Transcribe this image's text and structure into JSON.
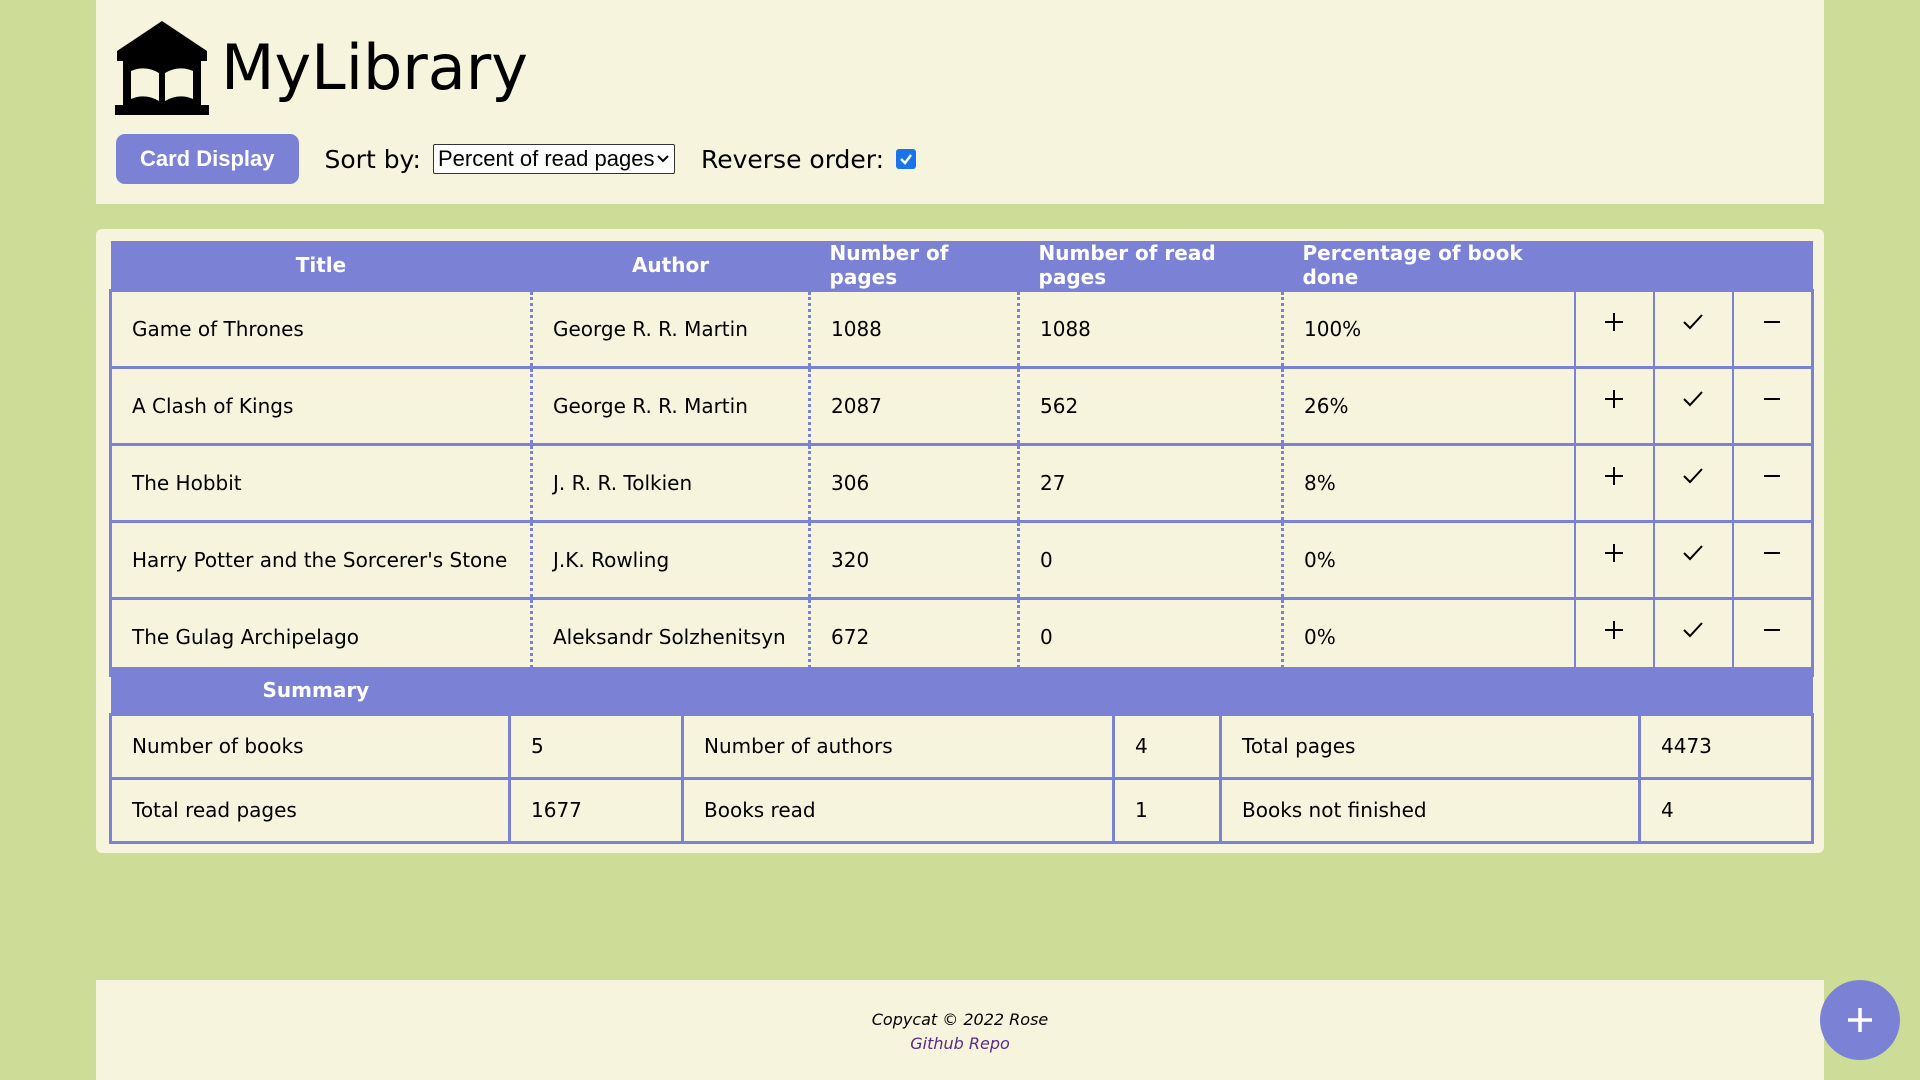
{
  "header": {
    "app_title": "MyLibrary",
    "logo_icon": "library-building-icon",
    "card_display_label": "Card Display",
    "sort_label": "Sort by:",
    "sort_selected": "Percent of read pages",
    "reverse_label": "Reverse order:",
    "reverse_checked": true
  },
  "table": {
    "columns": [
      "Title",
      "Author",
      "Number of pages",
      "Number of read pages",
      "Percentage of book done"
    ],
    "actions": [
      "plus-icon",
      "check-icon",
      "minus-icon"
    ],
    "rows": [
      {
        "title": "Game of Thrones",
        "author": "George R. R. Martin",
        "pages": "1088",
        "read": "1088",
        "percent": "100%"
      },
      {
        "title": "A Clash of Kings",
        "author": "George R. R. Martin",
        "pages": "2087",
        "read": "562",
        "percent": "26%"
      },
      {
        "title": "The Hobbit",
        "author": "J. R. R. Tolkien",
        "pages": "306",
        "read": "27",
        "percent": "8%"
      },
      {
        "title": "Harry Potter and the Sorcerer's Stone",
        "author": "J.K. Rowling",
        "pages": "320",
        "read": "0",
        "percent": "0%"
      },
      {
        "title": "The Gulag Archipelago",
        "author": "Aleksandr Solzhenitsyn",
        "pages": "672",
        "read": "0",
        "percent": "0%"
      }
    ]
  },
  "summary": {
    "heading": "Summary",
    "number_of_books_label": "Number of books",
    "number_of_books": "5",
    "number_of_authors_label": "Number of authors",
    "number_of_authors": "4",
    "total_pages_label": "Total pages",
    "total_pages": "4473",
    "total_read_pages_label": "Total read pages",
    "total_read_pages": "1677",
    "books_read_label": "Books read",
    "books_read": "1",
    "books_not_finished_label": "Books not finished",
    "books_not_finished": "4"
  },
  "footer": {
    "copyright": "Copycat © 2022 Rose",
    "repo_link": "Github Repo"
  },
  "fab_icon": "plus-icon",
  "colors": {
    "background": "#cddd98",
    "panel": "#f6f4dd",
    "accent": "#7b82d6",
    "link": "#5a2a8a"
  }
}
